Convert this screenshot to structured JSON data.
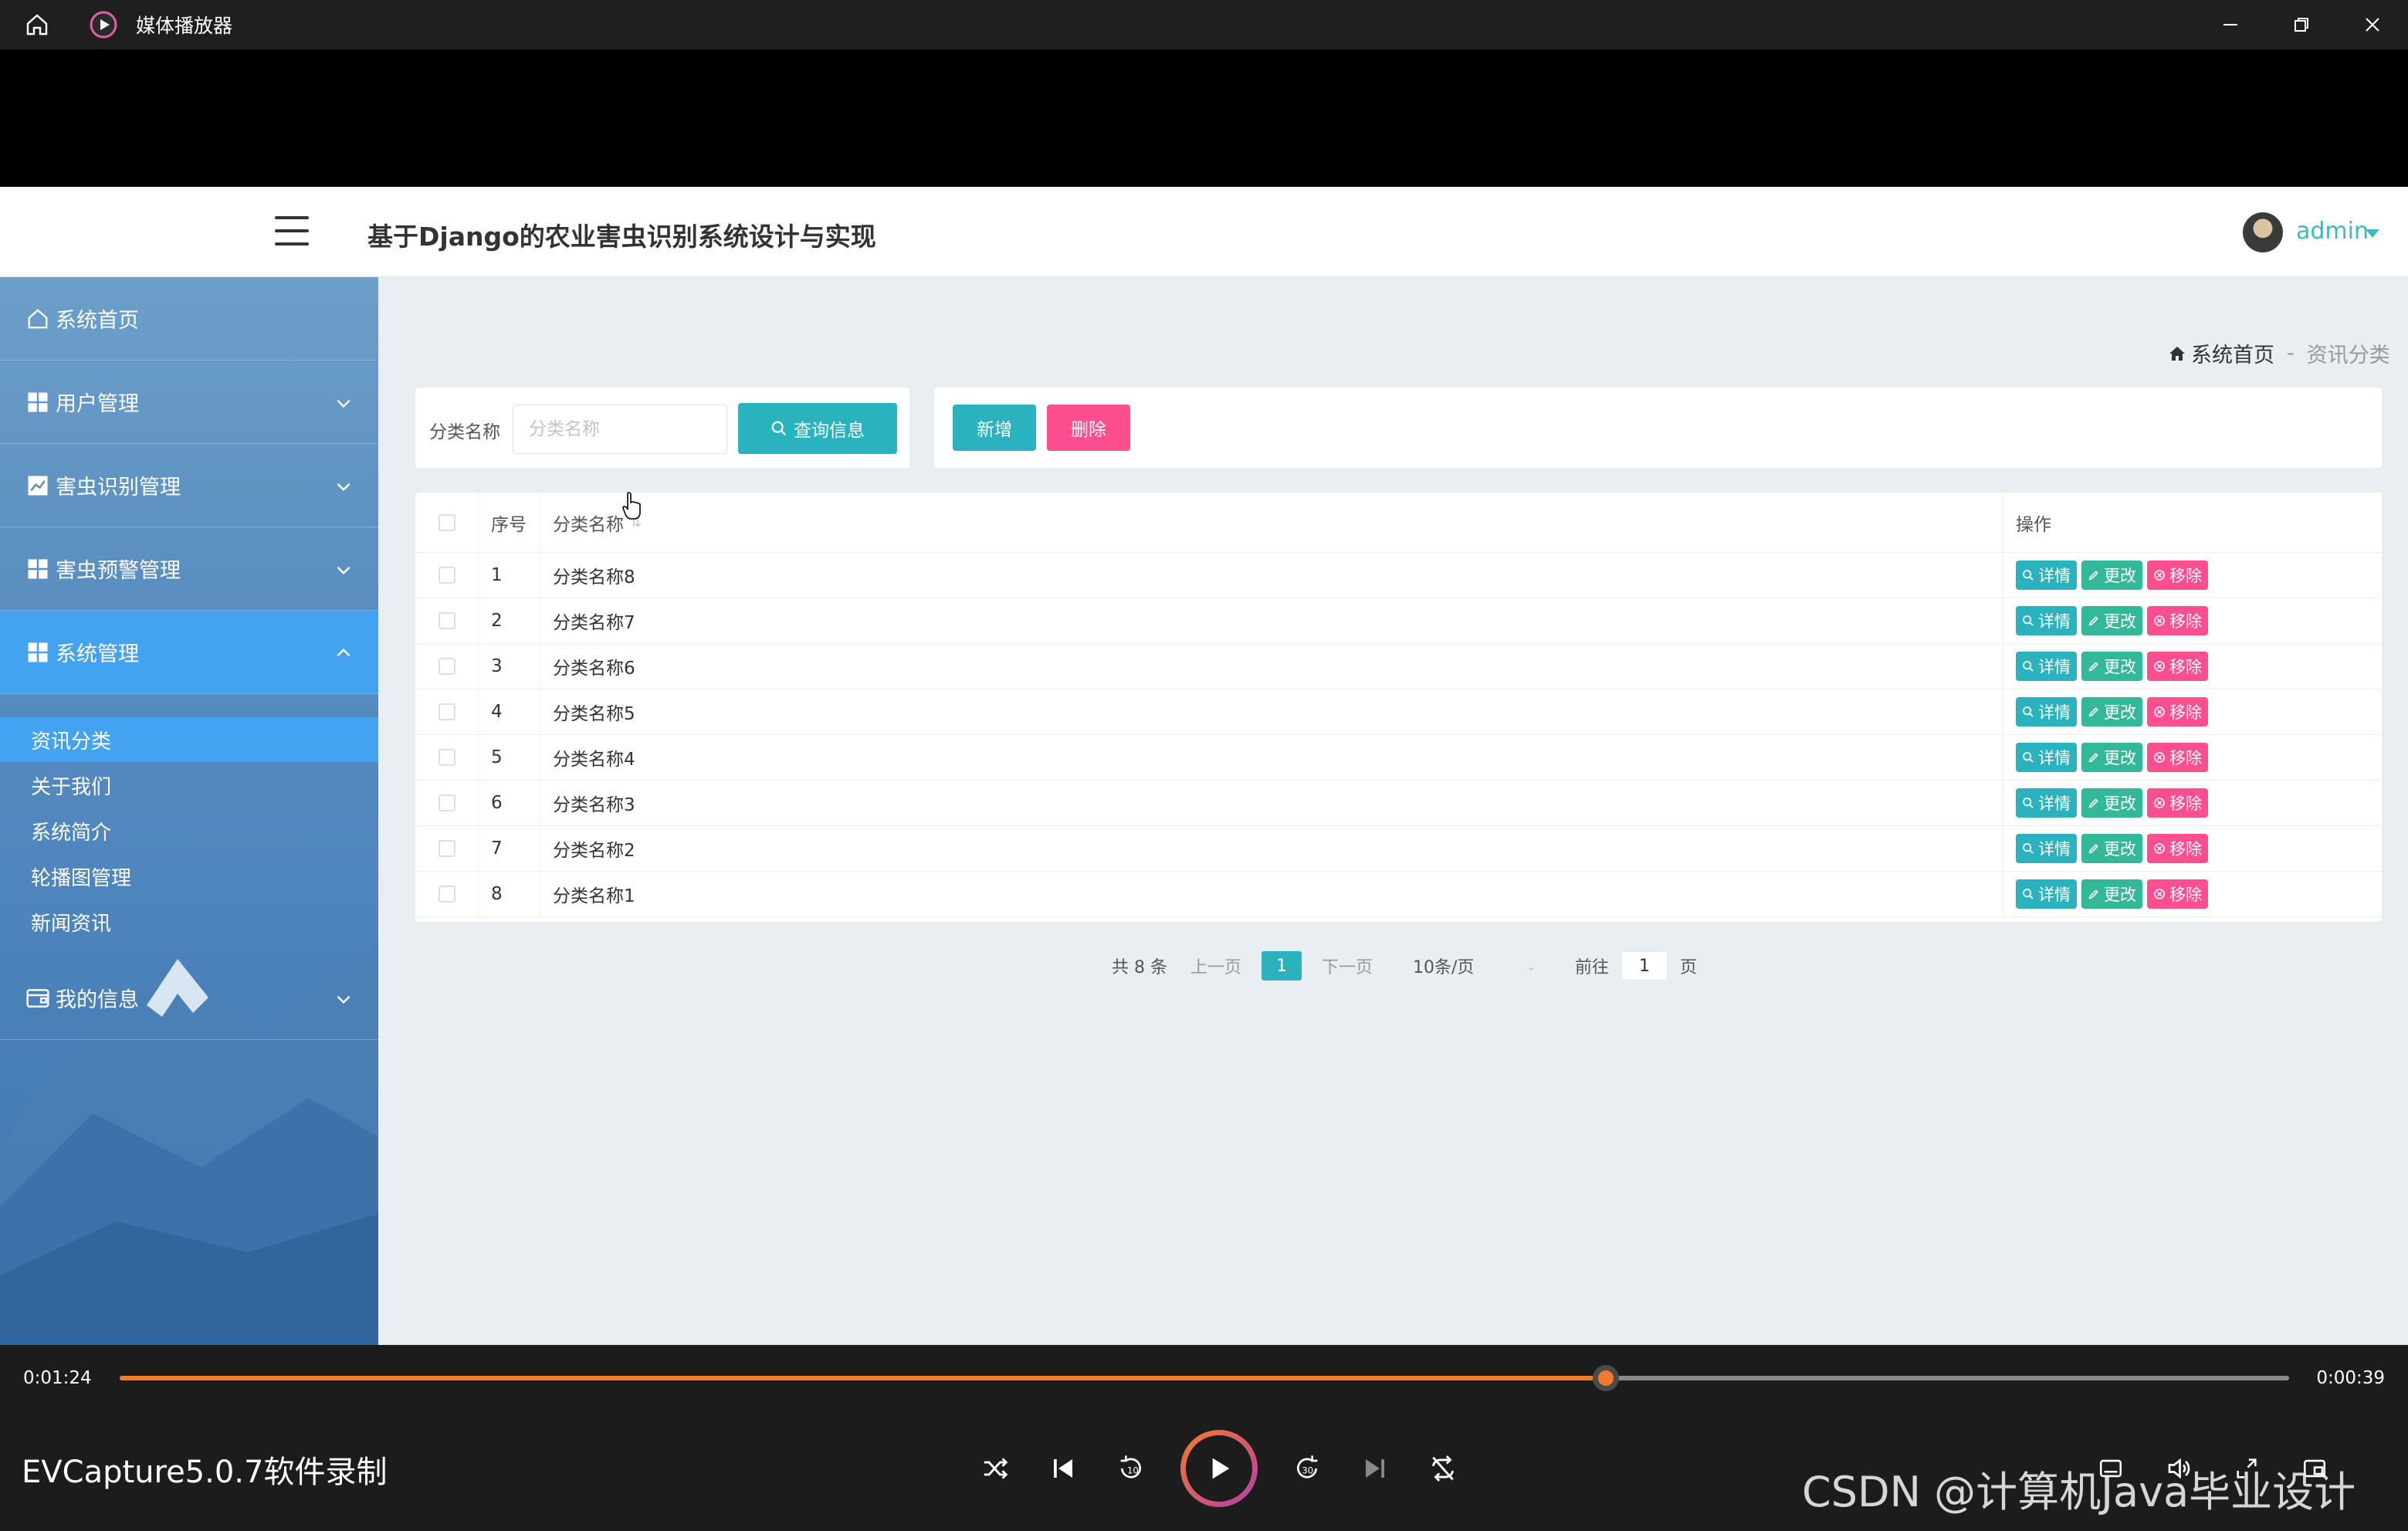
{
  "player": {
    "title": "媒体播放器",
    "time_current": "0:01:24",
    "time_total": "0:00:39",
    "progress_fraction": 0.685,
    "video_name": "EVCapture5.0.7软件录制",
    "watermark": "CSDN @计算机Java毕业设计",
    "accent": "#f07b2f"
  },
  "header": {
    "site_title": "基于Django的农业害虫识别系统设计与实现",
    "user_name": "admin"
  },
  "sidebar": {
    "items": [
      {
        "label": "系统首页",
        "icon": "home-icon"
      },
      {
        "label": "用户管理",
        "icon": "grid-icon"
      },
      {
        "label": "害虫识别管理",
        "icon": "chart-icon"
      },
      {
        "label": "害虫预警管理",
        "icon": "grid-icon"
      },
      {
        "label": "系统管理",
        "icon": "grid-icon"
      },
      {
        "label": "我的信息",
        "icon": "wallet-icon"
      }
    ],
    "sub_items": [
      "资讯分类",
      "关于我们",
      "系统简介",
      "轮播图管理",
      "新闻资讯"
    ]
  },
  "breadcrumb": {
    "home": "系统首页",
    "separator": "-",
    "current": "资讯分类"
  },
  "search": {
    "label": "分类名称",
    "placeholder": "分类名称",
    "button_label": "查询信息"
  },
  "actions": {
    "add_label": "新增",
    "delete_label": "删除"
  },
  "table": {
    "columns": [
      "序号",
      "分类名称",
      "操作"
    ],
    "op_labels": {
      "detail": "详情",
      "edit": "更改",
      "remove": "移除"
    },
    "rows": [
      {
        "no": "1",
        "name": "分类名称8"
      },
      {
        "no": "2",
        "name": "分类名称7"
      },
      {
        "no": "3",
        "name": "分类名称6"
      },
      {
        "no": "4",
        "name": "分类名称5"
      },
      {
        "no": "5",
        "name": "分类名称4"
      },
      {
        "no": "6",
        "name": "分类名称3"
      },
      {
        "no": "7",
        "name": "分类名称2"
      },
      {
        "no": "8",
        "name": "分类名称1"
      }
    ]
  },
  "pagination": {
    "total": "共 8 条",
    "prev": "上一页",
    "current_page": "1",
    "next": "下一页",
    "page_size": "10条/页",
    "goto_label": "前往",
    "goto_value": "1",
    "page_unit": "页"
  },
  "colors": {
    "primary": "#2ab3bf",
    "success": "#34b89a",
    "danger": "#fd4f8f",
    "sidebar_active": "#43a3f0"
  }
}
